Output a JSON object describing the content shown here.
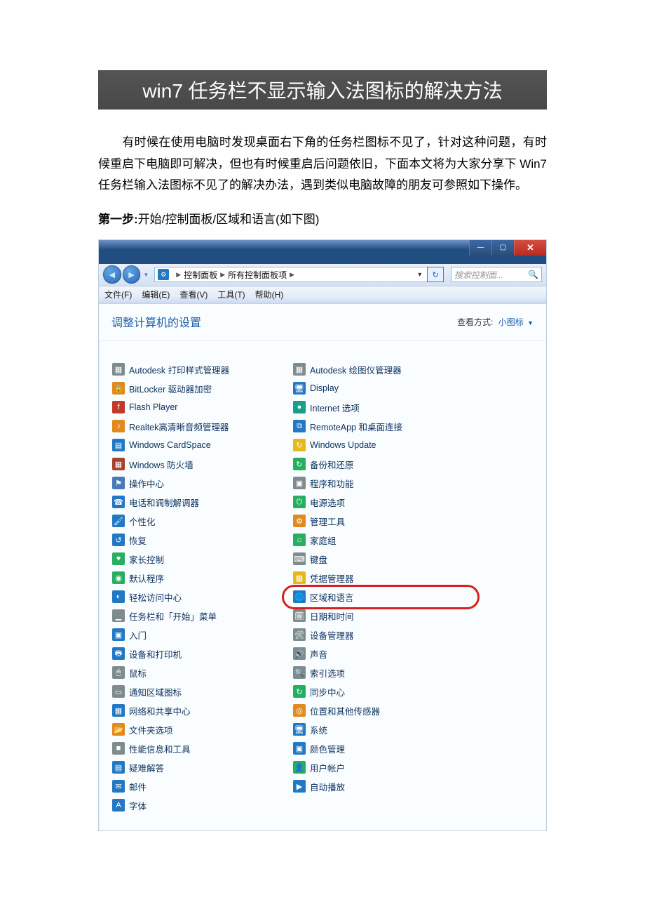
{
  "article": {
    "title": "win7 任务栏不显示输入法图标的解决方法",
    "body": "有时候在使用电脑时发现桌面右下角的任务栏图标不见了，针对这种问题，有时候重启下电脑即可解决，但也有时候重启后问题依旧，下面本文将为大家分享下 Win7 任务栏输入法图标不见了的解决办法，遇到类似电脑故障的朋友可参照如下操作。",
    "step1_bold": "第一步:",
    "step1_text": "开始/控制面板/区域和语言(如下图)"
  },
  "address": {
    "crumb1": "控制面板",
    "crumb2": "所有控制面板项",
    "search_placeholder": "搜索控制面..."
  },
  "menu": {
    "file": "文件(F)",
    "edit": "编辑(E)",
    "view": "查看(V)",
    "tools": "工具(T)",
    "help": "帮助(H)"
  },
  "content_head": {
    "title": "调整计算机的设置",
    "view_label": "查看方式:",
    "view_value": "小图标"
  },
  "items": [
    {
      "name": "autodesk-print",
      "label": "Autodesk 打印样式管理器",
      "iconClass": "ic-gray",
      "glyph": "▦"
    },
    {
      "name": "autodesk-plot",
      "label": "Autodesk 绘图仪管理器",
      "iconClass": "ic-gray",
      "glyph": "▦"
    },
    {
      "name": "bitlocker",
      "label": "BitLocker 驱动器加密",
      "iconClass": "ic-orange",
      "glyph": "🔒"
    },
    {
      "name": "display",
      "label": "Display",
      "iconClass": "ic-blue",
      "glyph": "🖥"
    },
    {
      "name": "flash",
      "label": "Flash Player",
      "iconClass": "ic-red",
      "glyph": "f"
    },
    {
      "name": "internet-options",
      "label": "Internet 选项",
      "iconClass": "ic-teal",
      "glyph": "●"
    },
    {
      "name": "realtek",
      "label": "Realtek高清晰音频管理器",
      "iconClass": "ic-orange",
      "glyph": "♪"
    },
    {
      "name": "remoteapp",
      "label": "RemoteApp 和桌面连接",
      "iconClass": "ic-blue",
      "glyph": "⧉"
    },
    {
      "name": "cardspace",
      "label": "Windows CardSpace",
      "iconClass": "ic-blue",
      "glyph": "▤"
    },
    {
      "name": "win-update",
      "label": "Windows Update",
      "iconClass": "ic-yellow",
      "glyph": "↻"
    },
    {
      "name": "firewall",
      "label": "Windows 防火墙",
      "iconClass": "ic-brick",
      "glyph": "▦"
    },
    {
      "name": "backup",
      "label": "备份和还原",
      "iconClass": "ic-green",
      "glyph": "↻"
    },
    {
      "name": "action-center",
      "label": "操作中心",
      "iconClass": "ic-nav",
      "glyph": "⚑"
    },
    {
      "name": "programs",
      "label": "程序和功能",
      "iconClass": "ic-gray",
      "glyph": "▣"
    },
    {
      "name": "phone-modem",
      "label": "电话和调制解调器",
      "iconClass": "ic-blue",
      "glyph": "☎"
    },
    {
      "name": "power",
      "label": "电源选项",
      "iconClass": "ic-green",
      "glyph": "⏻"
    },
    {
      "name": "personalization",
      "label": "个性化",
      "iconClass": "ic-blue",
      "glyph": "🖌"
    },
    {
      "name": "admin-tools",
      "label": "管理工具",
      "iconClass": "ic-orange",
      "glyph": "⚙"
    },
    {
      "name": "recovery",
      "label": "恢复",
      "iconClass": "ic-blue",
      "glyph": "↺"
    },
    {
      "name": "homegroup",
      "label": "家庭组",
      "iconClass": "ic-green",
      "glyph": "⌂"
    },
    {
      "name": "parental",
      "label": "家长控制",
      "iconClass": "ic-green",
      "glyph": "♥"
    },
    {
      "name": "keyboard",
      "label": "键盘",
      "iconClass": "ic-gray",
      "glyph": "⌨"
    },
    {
      "name": "default-prog",
      "label": "默认程序",
      "iconClass": "ic-green",
      "glyph": "◉"
    },
    {
      "name": "credential",
      "label": "凭据管理器",
      "iconClass": "ic-yellow",
      "glyph": "▦"
    },
    {
      "name": "easy-access",
      "label": "轻松访问中心",
      "iconClass": "ic-blue",
      "glyph": "◐"
    },
    {
      "name": "region-lang",
      "label": "区域和语言",
      "iconClass": "ic-blue",
      "glyph": "🌐",
      "highlight": true
    },
    {
      "name": "taskbar",
      "label": "任务栏和「开始」菜单",
      "iconClass": "ic-gray",
      "glyph": "▁"
    },
    {
      "name": "date-time",
      "label": "日期和时间",
      "iconClass": "ic-gray",
      "glyph": "🗓"
    },
    {
      "name": "getting-started",
      "label": "入门",
      "iconClass": "ic-blue",
      "glyph": "▣"
    },
    {
      "name": "device-mgr",
      "label": "设备管理器",
      "iconClass": "ic-gray",
      "glyph": "🛠"
    },
    {
      "name": "devices",
      "label": "设备和打印机",
      "iconClass": "ic-blue",
      "glyph": "🖶"
    },
    {
      "name": "sound",
      "label": "声音",
      "iconClass": "ic-gray",
      "glyph": "🔊"
    },
    {
      "name": "mouse",
      "label": "鼠标",
      "iconClass": "ic-gray",
      "glyph": "🖱"
    },
    {
      "name": "indexing",
      "label": "索引选项",
      "iconClass": "ic-gray",
      "glyph": "🔍"
    },
    {
      "name": "notif-icons",
      "label": "通知区域图标",
      "iconClass": "ic-gray",
      "glyph": "▭"
    },
    {
      "name": "sync-center",
      "label": "同步中心",
      "iconClass": "ic-green",
      "glyph": "↻"
    },
    {
      "name": "network",
      "label": "网络和共享中心",
      "iconClass": "ic-blue",
      "glyph": "▦"
    },
    {
      "name": "location",
      "label": "位置和其他传感器",
      "iconClass": "ic-orange",
      "glyph": "◎"
    },
    {
      "name": "folder-opts",
      "label": "文件夹选项",
      "iconClass": "ic-orange",
      "glyph": "📂"
    },
    {
      "name": "system",
      "label": "系统",
      "iconClass": "ic-blue",
      "glyph": "🖥"
    },
    {
      "name": "perf-info",
      "label": "性能信息和工具",
      "iconClass": "ic-gray",
      "glyph": "■"
    },
    {
      "name": "color-mgmt",
      "label": "颜色管理",
      "iconClass": "ic-blue",
      "glyph": "▣"
    },
    {
      "name": "troubleshoot",
      "label": "疑难解答",
      "iconClass": "ic-blue",
      "glyph": "▤"
    },
    {
      "name": "user-accounts",
      "label": "用户帐户",
      "iconClass": "ic-green",
      "glyph": "👤"
    },
    {
      "name": "mail",
      "label": "邮件",
      "iconClass": "ic-blue",
      "glyph": "✉"
    },
    {
      "name": "autoplay",
      "label": "自动播放",
      "iconClass": "ic-blue",
      "glyph": "▶"
    },
    {
      "name": "fonts",
      "label": "字体",
      "iconClass": "ic-blue",
      "glyph": "A"
    }
  ]
}
